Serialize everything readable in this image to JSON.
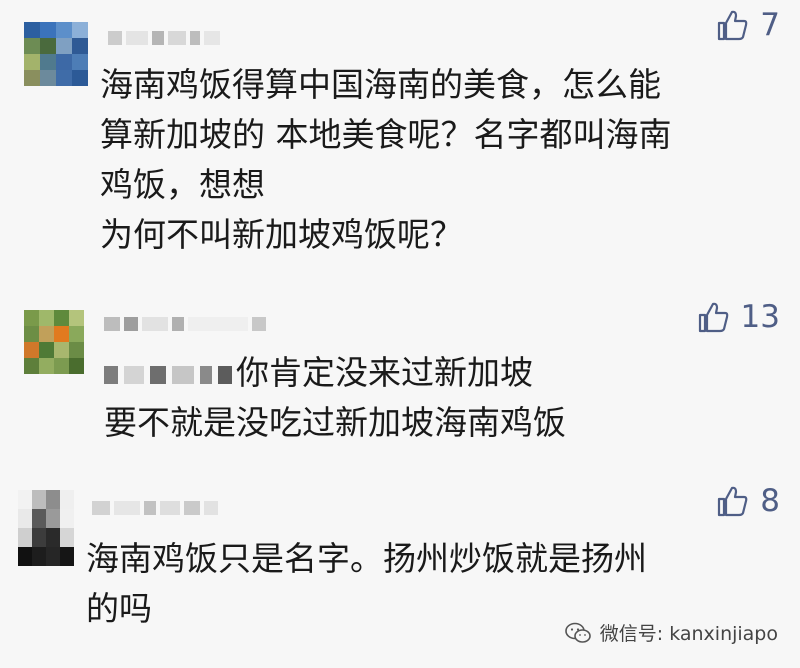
{
  "comments": [
    {
      "likes": "7",
      "text": "海南鸡饭得算中国海南的美食，怎么能\n算新加坡的 本地美食呢？名字都叫海南\n鸡饭，想想\n为何不叫新加坡鸡饭呢？"
    },
    {
      "likes": "13",
      "text_line1": "你肯定没来过新加坡",
      "text_line2": "要不就是没吃过新加坡海南鸡饭"
    },
    {
      "likes": "8",
      "text": "海南鸡饭只是名字。扬州炒饭就是扬州\n的吗"
    }
  ],
  "icons": {
    "like": "thumbs-up-icon",
    "wechat": "wechat-icon"
  },
  "colors": {
    "like": "#4f5e86"
  },
  "watermark": "微信号: kanxinjiapo"
}
